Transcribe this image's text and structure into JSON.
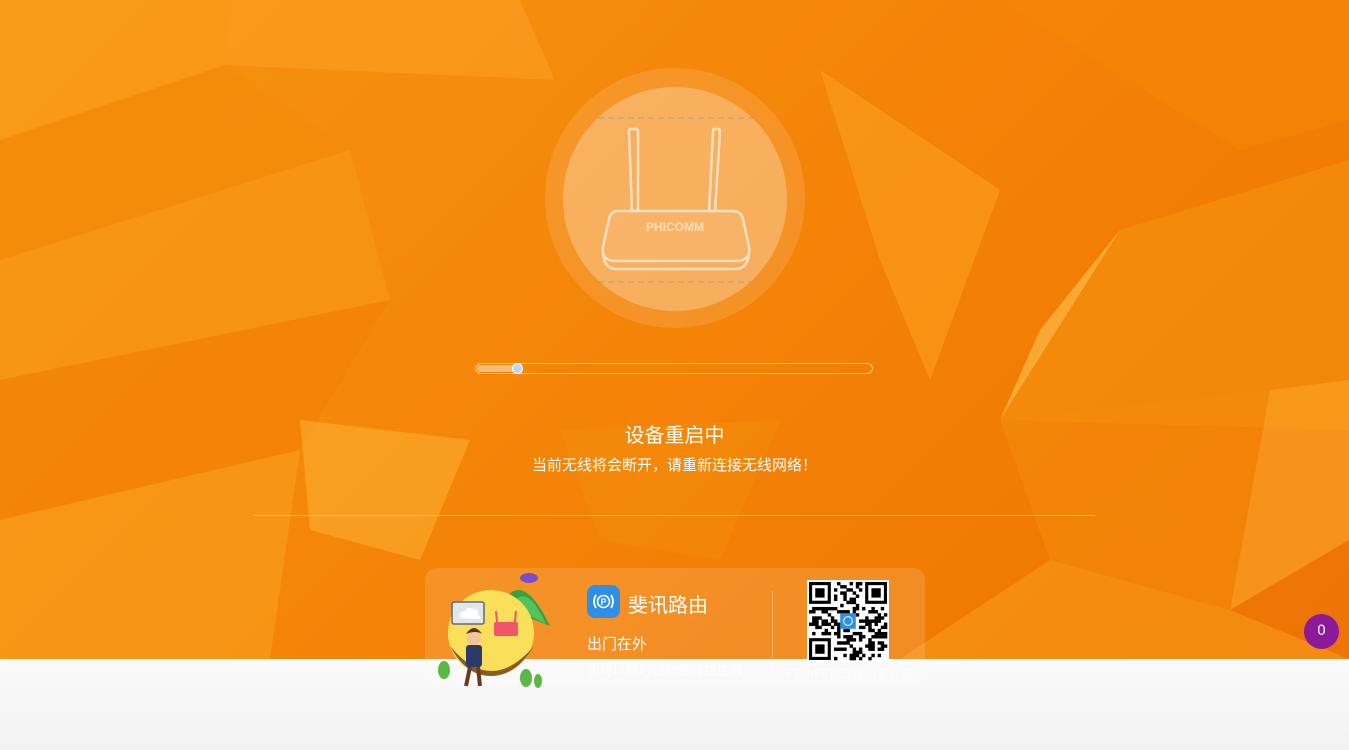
{
  "device": {
    "brand_label": "PHICOMM",
    "reboot_progress_percent": 10
  },
  "status": {
    "title": "设备重启中",
    "message": "当前无线将会断开，请重新连接无线网络！"
  },
  "promo": {
    "app_name": "斐讯路由",
    "app_icon": "phicomm-p-icon",
    "line1": "出门在外",
    "line2": "也可以随时随地管理路由器",
    "qr_caption": "下载APP管理路由更方便"
  },
  "notification_badge": {
    "count": "0"
  },
  "colors": {
    "background": "#f5870a",
    "badge": "#8a1a9a",
    "app_icon": "#2e8fe8"
  }
}
